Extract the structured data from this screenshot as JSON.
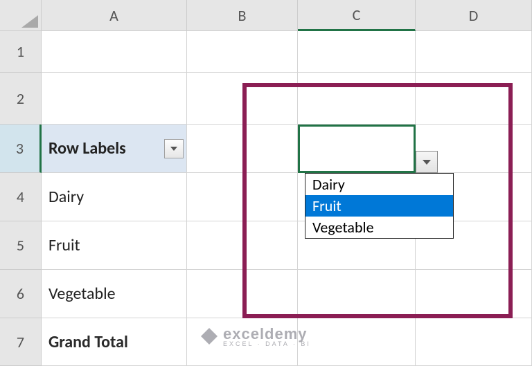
{
  "columns": {
    "A": "A",
    "B": "B",
    "C": "C",
    "D": "D"
  },
  "rows": {
    "r1": "1",
    "r2": "2",
    "r3": "3",
    "r4": "4",
    "r5": "5",
    "r6": "6",
    "r7": "7"
  },
  "pivot": {
    "header": "Row Labels",
    "items": [
      "Dairy",
      "Fruit",
      "Vegetable"
    ],
    "grand_total": "Grand Total"
  },
  "dropdown": {
    "options": [
      "Dairy",
      "Fruit",
      "Vegetable"
    ],
    "selected_index": 1
  },
  "watermark": {
    "title": "exceldemy",
    "sub": "EXCEL · DATA · BI"
  }
}
